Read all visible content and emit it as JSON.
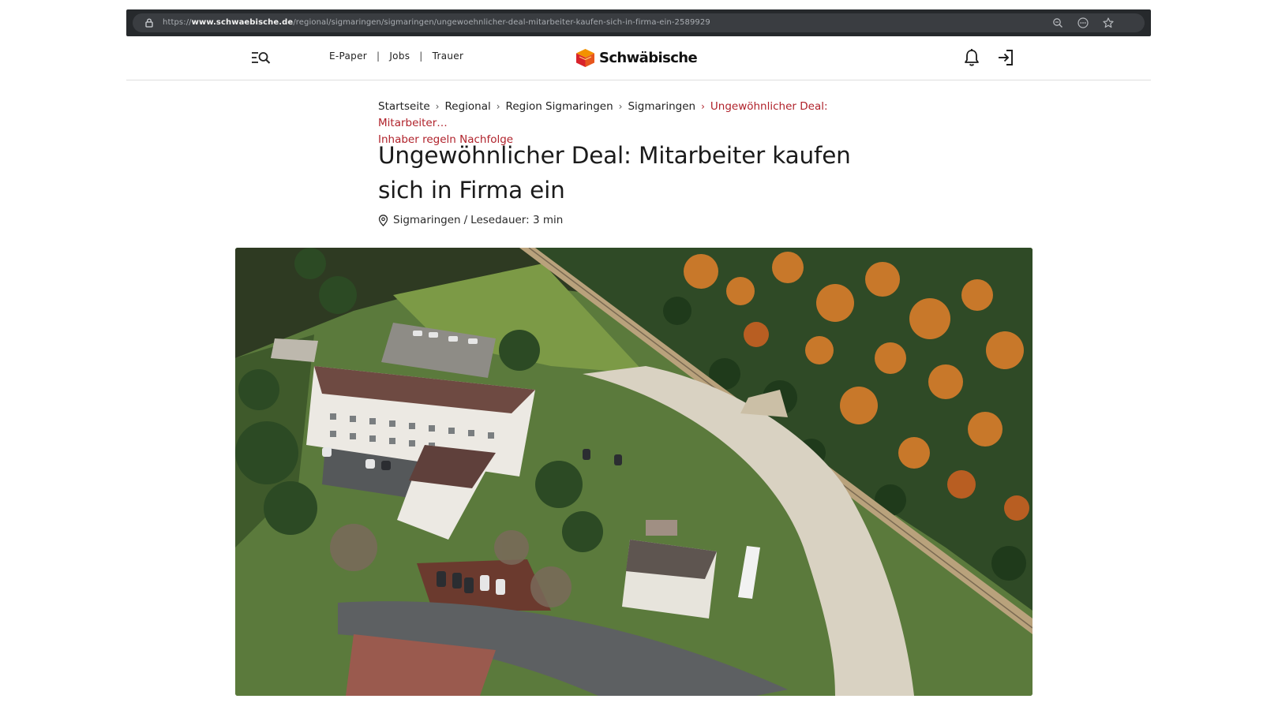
{
  "browser": {
    "url_prefix": "https://",
    "url_domain": "www.schwaebische.de",
    "url_path": "/regional/sigmaringen/sigmaringen/ungewoehnlicher-deal-mitarbeiter-kaufen-sich-in-firma-ein-2589929"
  },
  "header": {
    "nav": [
      "E-Paper",
      "Jobs",
      "Trauer"
    ],
    "logo_text": "Schwäbische",
    "brand_colors": {
      "orange": "#f39200",
      "red": "#d8222b"
    }
  },
  "breadcrumb": {
    "items": [
      "Startseite",
      "Regional",
      "Region Sigmaringen",
      "Sigmaringen"
    ],
    "current": "Ungewöhnlicher Deal: Mitarbeiter…",
    "current_line2": "Inhaber regeln Nachfolge",
    "accent_color": "#b0222b"
  },
  "article": {
    "headline": "Ungewöhnlicher Deal: Mitarbeiter kaufen sich in Firma ein",
    "location": "Sigmaringen",
    "separator": "/",
    "reading_time": "Lesedauer: 3 min"
  },
  "hero_image": {
    "subject": "aerial-photo-buildings-forest"
  }
}
